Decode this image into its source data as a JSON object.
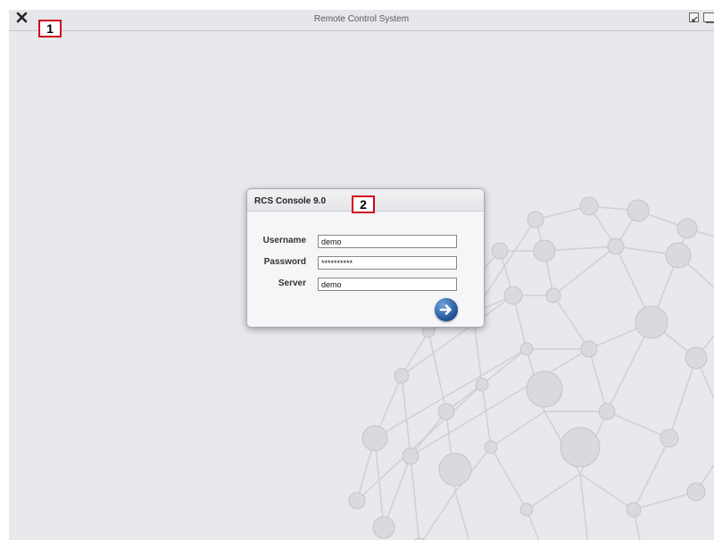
{
  "window": {
    "title": "Remote Control System"
  },
  "callouts": {
    "first": "1",
    "second": "2"
  },
  "dialog": {
    "title": "RCS Console 9.0",
    "fields": {
      "username": {
        "label": "Username",
        "value": "demo"
      },
      "password": {
        "label": "Password",
        "value": "**********"
      },
      "server": {
        "label": "Server",
        "value": "demo"
      }
    }
  },
  "icons": {
    "close": "close-icon",
    "restore": "restore-window-icon",
    "minimize": "minimize-window-icon",
    "submit": "arrow-right-icon",
    "background": "network-sphere-icon"
  },
  "colors": {
    "background": "#e8e9ec",
    "accent": "#1d4f95",
    "callout_border": "#d0021b"
  }
}
